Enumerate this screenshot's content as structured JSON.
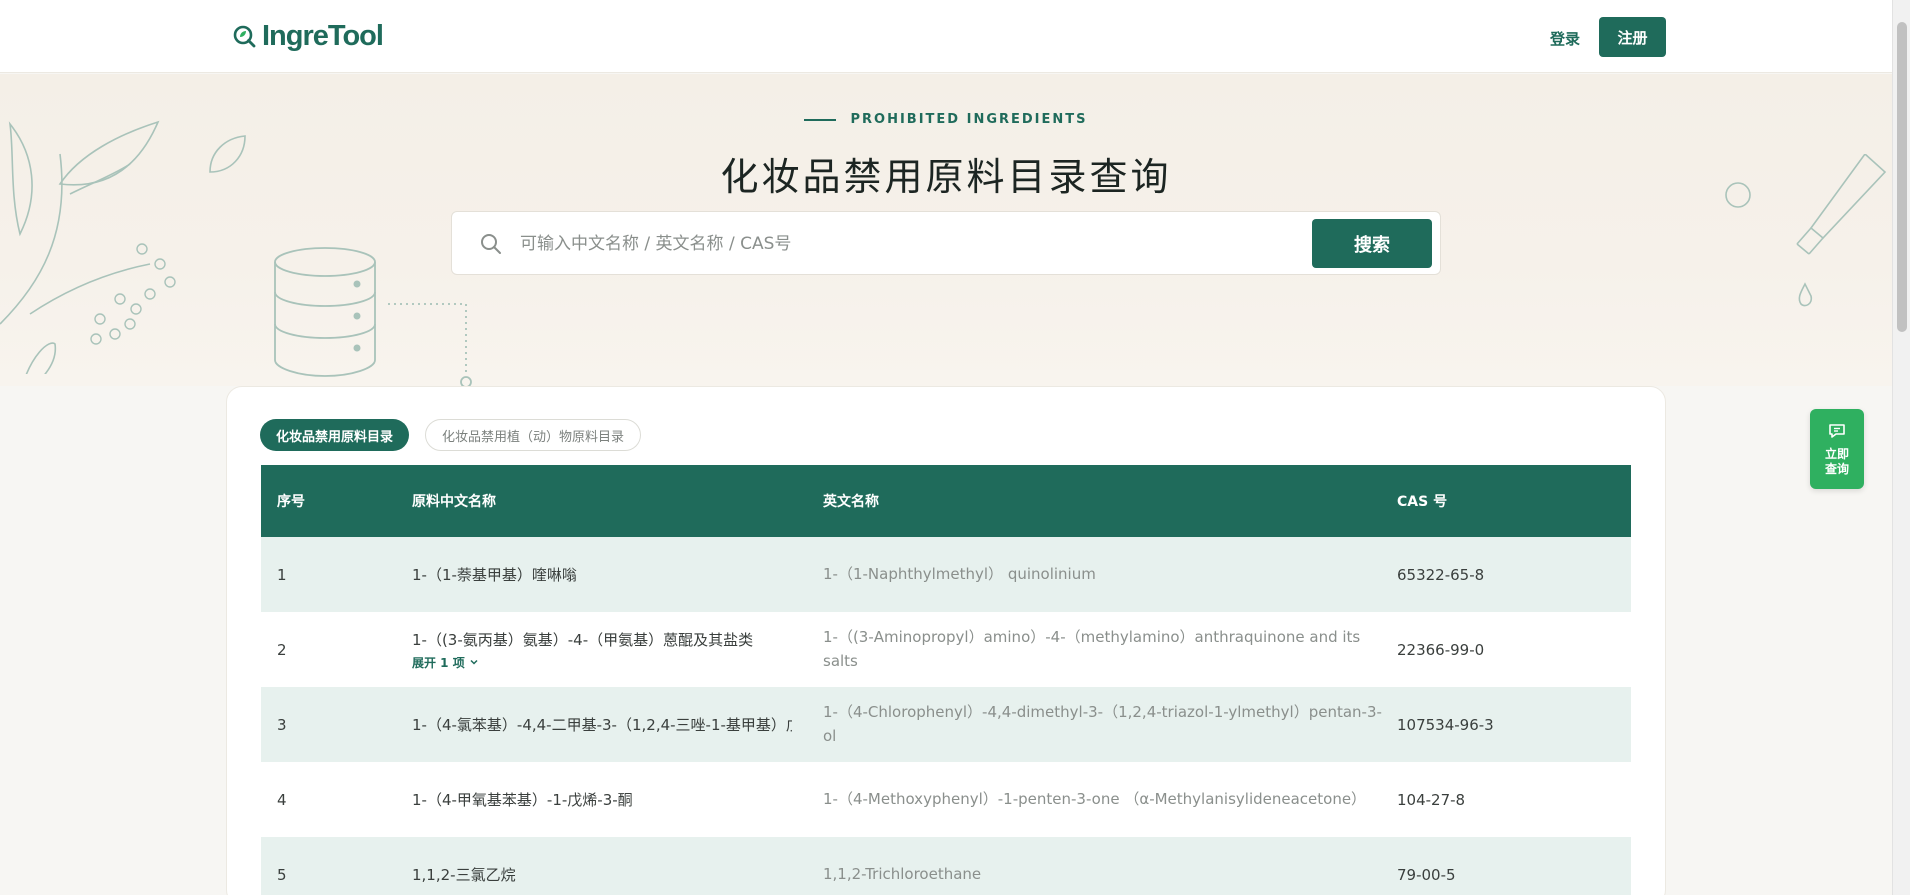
{
  "header": {
    "logo_text": "IngreTool",
    "login_label": "登录",
    "register_label": "注册"
  },
  "hero": {
    "eyebrow": "PROHIBITED INGREDIENTS",
    "title": "化妆品禁用原料目录查询",
    "search_placeholder": "可输入中文名称 / 英文名称 / CAS号",
    "search_button": "搜索"
  },
  "tabs": [
    {
      "label": "化妆品禁用原料目录",
      "active": true
    },
    {
      "label": "化妆品禁用植（动）物原料目录",
      "active": false
    }
  ],
  "table": {
    "headers": [
      "序号",
      "原料中文名称",
      "英文名称",
      "CAS 号"
    ],
    "rows": [
      {
        "no": "1",
        "cn": "1-（1-萘基甲基）喹啉嗡",
        "en": "1-（1-Naphthylmethyl） quinolinium",
        "cas": "65322-65-8"
      },
      {
        "no": "2",
        "cn": "1-（(3-氨丙基）氨基）-4-（甲氨基）蒽醌及其盐类",
        "expand": "展开 1 项",
        "en": "1-（(3-Aminopropyl）amino）-4-（methylamino）anthraquinone and its salts",
        "cas": "22366-99-0"
      },
      {
        "no": "3",
        "cn": "1-（4-氯苯基）-4,4-二甲基-3-（1,2,4-三唑-1-基甲基）戊",
        "en": "1-（4-Chlorophenyl）-4,4-dimethyl-3-（1,2,4-triazol-1-ylmethyl）pentan-3-ol",
        "cas": "107534-96-3"
      },
      {
        "no": "4",
        "cn": "1-（4-甲氧基苯基）-1-戊烯-3-酮",
        "en": "1-（4-Methoxyphenyl）-1-penten-3-one （α-Methylanisylideneacetone）",
        "cas": "104-27-8"
      },
      {
        "no": "5",
        "cn": "1,1,2-三氯乙烷",
        "en": "1,1,2-Trichloroethane",
        "cas": "79-00-5"
      }
    ]
  },
  "consult": {
    "line1": "立即",
    "line2": "查询"
  },
  "colors": {
    "primary": "#1f6b5b",
    "row_tint": "#e7f1ee",
    "consult": "#2fb060"
  }
}
